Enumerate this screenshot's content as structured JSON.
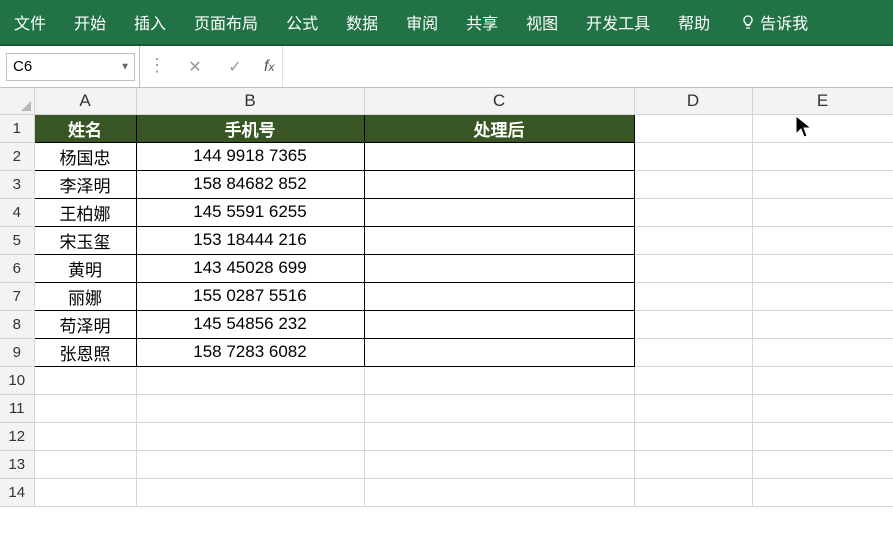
{
  "ribbon": {
    "tabs": [
      "文件",
      "开始",
      "插入",
      "页面布局",
      "公式",
      "数据",
      "审阅",
      "共享",
      "视图",
      "开发工具",
      "帮助"
    ],
    "tell_me": "告诉我"
  },
  "namebox": {
    "value": "C6"
  },
  "formula_bar": {
    "value": ""
  },
  "columns": [
    "A",
    "B",
    "C",
    "D",
    "E"
  ],
  "headers": {
    "A": "姓名",
    "B": "手机号",
    "C": "处理后"
  },
  "rows": [
    {
      "n": 1
    },
    {
      "n": 2,
      "A": "杨国忠",
      "B": "144 9918  7365",
      "C": ""
    },
    {
      "n": 3,
      "A": "李泽明",
      "B": "158 84682 852",
      "C": ""
    },
    {
      "n": 4,
      "A": "王柏娜",
      "B": "145 5591 6255",
      "C": ""
    },
    {
      "n": 5,
      "A": "宋玉玺",
      "B": "153 18444 216",
      "C": ""
    },
    {
      "n": 6,
      "A": "黄明",
      "B": "143 45028 699",
      "C": ""
    },
    {
      "n": 7,
      "A": "丽娜",
      "B": "155 0287 5516",
      "C": ""
    },
    {
      "n": 8,
      "A": "苟泽明",
      "B": "145 54856 232",
      "C": ""
    },
    {
      "n": 9,
      "A": "张恩照",
      "B": "158 7283 6082",
      "C": ""
    },
    {
      "n": 10
    },
    {
      "n": 11
    },
    {
      "n": 12
    },
    {
      "n": 13
    },
    {
      "n": 14
    }
  ]
}
